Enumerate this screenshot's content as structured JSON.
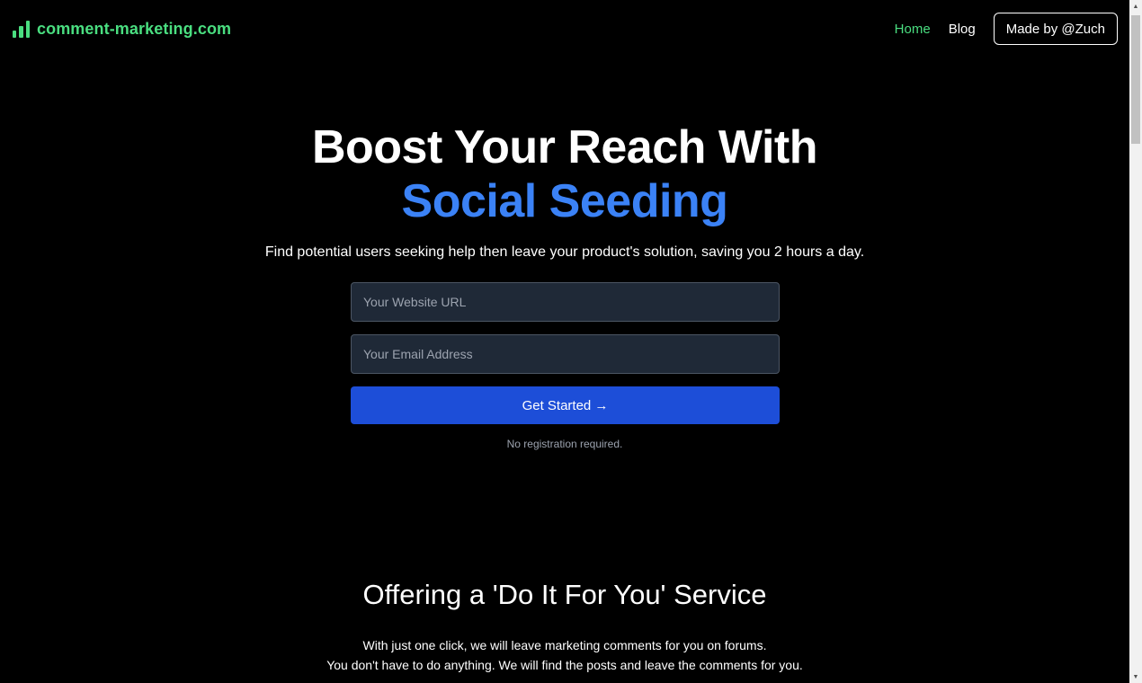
{
  "header": {
    "logo_text": "comment-marketing.com",
    "nav": {
      "home": "Home",
      "blog": "Blog",
      "made_by": "Made by @Zuch"
    }
  },
  "hero": {
    "title_line1": "Boost Your Reach With",
    "title_line2": "Social Seeding",
    "subtitle": "Find potential users seeking help then leave your product's solution, saving you 2 hours a day.",
    "url_placeholder": "Your Website URL",
    "email_placeholder": "Your Email Address",
    "cta_label": "Get Started →",
    "note": "No registration required."
  },
  "service": {
    "title": "Offering a 'Do It For You' Service",
    "line1": "With just one click, we will leave marketing comments for you on forums.",
    "line2": "You don't have to do anything. We will find the posts and leave the comments for you."
  },
  "colors": {
    "background": "#000000",
    "brand_green": "#4ade80",
    "accent_blue": "#3b82f6",
    "button_blue": "#1d4ed8",
    "input_bg": "#1f2937"
  },
  "icons": {
    "logo": "bar-chart-icon",
    "scroll_up": "triangle-up-icon",
    "scroll_down": "triangle-down-icon"
  }
}
